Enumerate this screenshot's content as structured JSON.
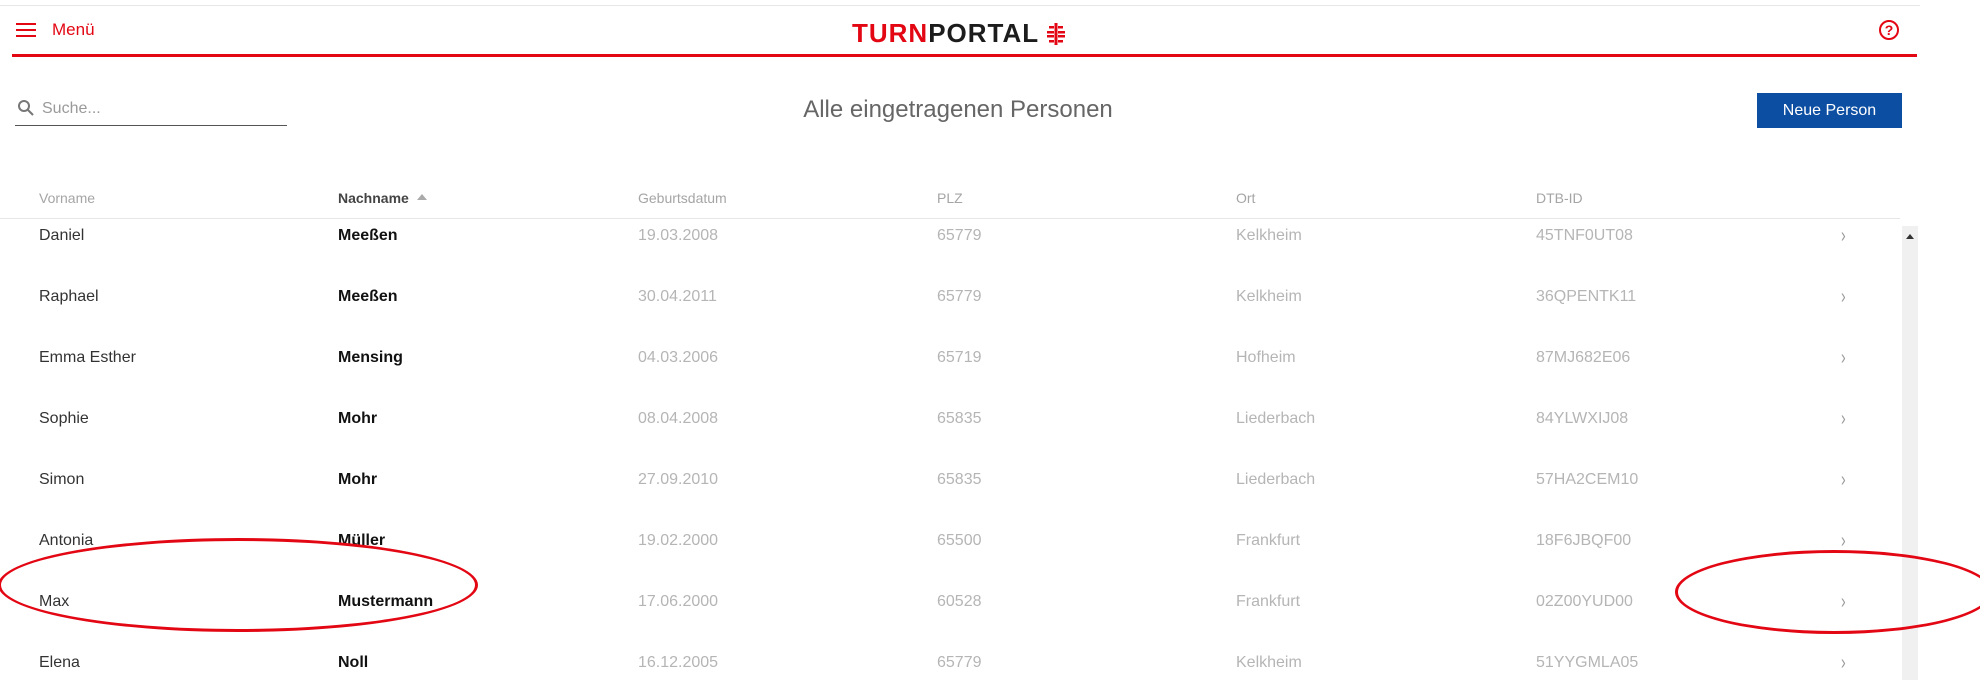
{
  "header": {
    "menu_label": "Menü",
    "logo_part1": "TURN",
    "logo_part2": "PORTAL",
    "help_symbol": "?",
    "accent_color": "#e30613"
  },
  "search": {
    "placeholder": "Suche...",
    "value": ""
  },
  "page_title": "Alle eingetragenen Personen",
  "new_person_button": "Neue Person",
  "table": {
    "columns": [
      "Vorname",
      "Nachname",
      "Geburtsdatum",
      "PLZ",
      "Ort",
      "DTB-ID"
    ],
    "sorted_column": "Nachname",
    "sort_direction": "ascending",
    "rows": [
      {
        "vorname": "Daniel",
        "nachname": "Meeßen",
        "geburtsdatum": "19.03.2008",
        "plz": "65779",
        "ort": "Kelkheim",
        "dtb_id": "45TNF0UT08"
      },
      {
        "vorname": "Raphael",
        "nachname": "Meeßen",
        "geburtsdatum": "30.04.2011",
        "plz": "65779",
        "ort": "Kelkheim",
        "dtb_id": "36QPENTK11"
      },
      {
        "vorname": "Emma Esther",
        "nachname": "Mensing",
        "geburtsdatum": "04.03.2006",
        "plz": "65719",
        "ort": "Hofheim",
        "dtb_id": "87MJ682E06"
      },
      {
        "vorname": "Sophie",
        "nachname": "Mohr",
        "geburtsdatum": "08.04.2008",
        "plz": "65835",
        "ort": "Liederbach",
        "dtb_id": "84YLWXIJ08"
      },
      {
        "vorname": "Simon",
        "nachname": "Mohr",
        "geburtsdatum": "27.09.2010",
        "plz": "65835",
        "ort": "Liederbach",
        "dtb_id": "57HA2CEM10"
      },
      {
        "vorname": "Antonia",
        "nachname": "Müller",
        "geburtsdatum": "19.02.2000",
        "plz": "65500",
        "ort": "Frankfurt",
        "dtb_id": "18F6JBQF00"
      },
      {
        "vorname": "Max",
        "nachname": "Mustermann",
        "geburtsdatum": "17.06.2000",
        "plz": "60528",
        "ort": "Frankfurt",
        "dtb_id": "02Z00YUD00"
      },
      {
        "vorname": "Elena",
        "nachname": "Noll",
        "geburtsdatum": "16.12.2005",
        "plz": "65779",
        "ort": "Kelkheim",
        "dtb_id": "51YYGMLA05"
      }
    ],
    "row_chevron": "›"
  },
  "icons": {
    "menu": "hamburger-icon",
    "search": "search-icon",
    "help": "help-circle-icon",
    "chevron": "chevron-right-icon",
    "logo_mark": "turnerkreuz-icon"
  },
  "colors": {
    "primary_button": "#0b4ea2",
    "annotation": "#e30613"
  }
}
